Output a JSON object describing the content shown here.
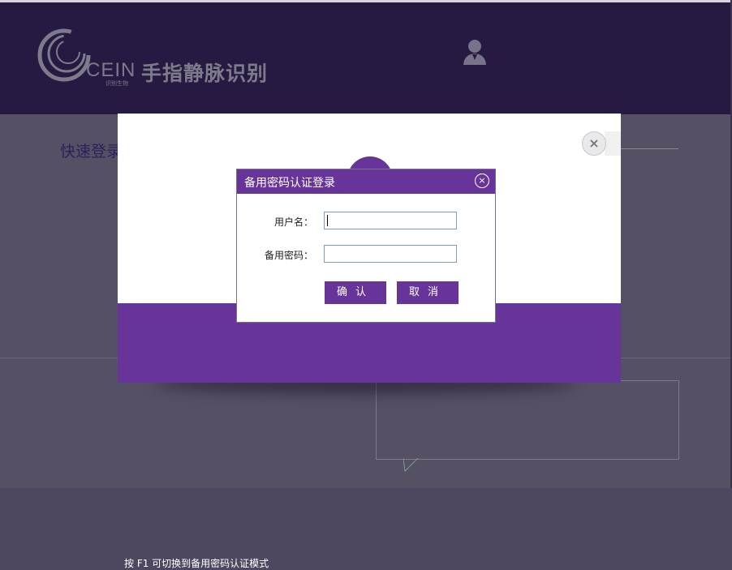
{
  "header": {
    "brand": "CEIN",
    "brand_sub": "识别生物",
    "app_title": "手指静脉识别"
  },
  "background": {
    "section_title": "快速登录"
  },
  "card": {
    "hint": "按 F1 可切换到备用密码认证模式",
    "close_symbol": "×"
  },
  "dialog": {
    "title": "备用密码认证登录",
    "close_symbol": "×",
    "username_label": "用户名：",
    "username_value": "",
    "password_label": "备用密码：",
    "password_value": "",
    "confirm_label": "确认",
    "cancel_label": "取消"
  },
  "colors": {
    "header_bg": "#261a43",
    "accent_purple": "#67349a",
    "overlay_bg": "#565065"
  },
  "icons": {
    "logo": "cein-swirl-logo",
    "user": "user-avatar-icon",
    "close": "close-icon"
  }
}
